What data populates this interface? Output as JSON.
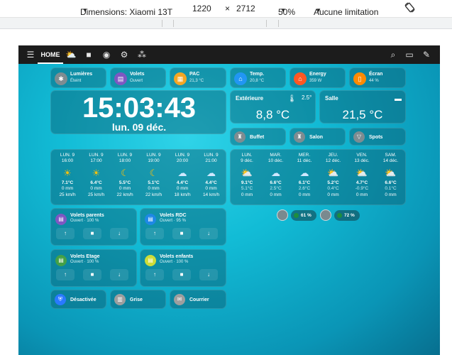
{
  "devtools": {
    "device_label": "Dimensions: Xiaomi 13T",
    "width_value": "1220",
    "times_sign": "×",
    "height_value": "2712",
    "zoom_label": "50%",
    "throttle_label": "Aucune limitation",
    "rotate_icon": "rotate-icon"
  },
  "topbar": {
    "menu_icon": "menu-icon",
    "home_tab": "HOME",
    "tab_icons": [
      "weather-icon",
      "camera-icon",
      "robot-icon",
      "settings-icon",
      "devices-icon"
    ],
    "right_icons": [
      "search-icon",
      "chat-icon",
      "edit-icon"
    ]
  },
  "chips": [
    {
      "label": "Lumières",
      "state": "Éteint",
      "icon": "lightbulb-icon",
      "color": "#7e8c91"
    },
    {
      "label": "Volets",
      "state": "Ouvert",
      "icon": "blinds-icon",
      "color": "#7e57c2"
    },
    {
      "label": "PAC",
      "state": "21,3 °C",
      "icon": "heat-pump-icon",
      "color": "#f5a623"
    },
    {
      "label": "Temp.",
      "state": "20,8 °C",
      "icon": "house-thermometer-icon",
      "color": "#2196f3"
    },
    {
      "label": "Energy",
      "state": "359 W",
      "icon": "house-energy-icon",
      "color": "#ff5722"
    },
    {
      "label": "Écran",
      "state": "44 %",
      "icon": "tablet-icon",
      "color": "#ff8a00"
    }
  ],
  "clock": {
    "time": "15:03:43",
    "date": "lun. 09 déc."
  },
  "thermo": [
    {
      "name": "Extérieure",
      "temp": "8,8 °C",
      "extra": "2.5°",
      "icon": "thermometer-icon"
    },
    {
      "name": "Salle",
      "temp": "21,5 °C",
      "extra": "",
      "icon": "sofa-icon"
    }
  ],
  "rooms": [
    {
      "label": "Buffet",
      "icon": "buffet-lamp-icon"
    },
    {
      "label": "Salon",
      "icon": "floor-lamp-icon"
    },
    {
      "label": "Spots",
      "icon": "spotlight-icon"
    }
  ],
  "hourly": [
    {
      "day": "LUN. 9",
      "time": "16:00",
      "icon": "sun-icon",
      "glyph": "☀",
      "color": "#ffc107",
      "temp": "7.1°C",
      "rain": "0 mm",
      "wind": "25 km/h"
    },
    {
      "day": "LUN. 9",
      "time": "17:00",
      "icon": "sun-icon",
      "glyph": "☀",
      "color": "#ffc107",
      "temp": "6.4°C",
      "rain": "0 mm",
      "wind": "25 km/h"
    },
    {
      "day": "LUN. 9",
      "time": "18:00",
      "icon": "moon-icon",
      "glyph": "☾",
      "color": "#ffc107",
      "temp": "5.5°C",
      "rain": "0 mm",
      "wind": "22 km/h"
    },
    {
      "day": "LUN. 9",
      "time": "19:00",
      "icon": "moon-icon",
      "glyph": "☾",
      "color": "#ffc107",
      "temp": "5.1°C",
      "rain": "0 mm",
      "wind": "22 km/h"
    },
    {
      "day": "LUN. 9",
      "time": "20:00",
      "icon": "partly-cloudy-night-icon",
      "glyph": "☁",
      "color": "#cfe8ff",
      "temp": "4.4°C",
      "rain": "0 mm",
      "wind": "18 km/h"
    },
    {
      "day": "LUN. 9",
      "time": "21:00",
      "icon": "partly-cloudy-night-icon",
      "glyph": "☁",
      "color": "#cfe8ff",
      "temp": "4.4°C",
      "rain": "0 mm",
      "wind": "14 km/h"
    }
  ],
  "daily": [
    {
      "day": "LUN.",
      "date": "9 déc.",
      "icon": "partly-sunny-icon",
      "glyph": "⛅",
      "color": "#ffd54f",
      "hi": "9.1°C",
      "lo": "5.1°C",
      "rain": "0 mm"
    },
    {
      "day": "MAR.",
      "date": "10 déc.",
      "icon": "cloudy-icon",
      "glyph": "☁",
      "color": "#cfe8ff",
      "hi": "6.6°C",
      "lo": "2.5°C",
      "rain": "0 mm"
    },
    {
      "day": "MER.",
      "date": "11 déc.",
      "icon": "cloudy-icon",
      "glyph": "☁",
      "color": "#cfe8ff",
      "hi": "6.1°C",
      "lo": "2.6°C",
      "rain": "0 mm"
    },
    {
      "day": "JEU.",
      "date": "12 déc.",
      "icon": "partly-sunny-icon",
      "glyph": "⛅",
      "color": "#ffd54f",
      "hi": "5.2°C",
      "lo": "0.4°C",
      "rain": "0 mm"
    },
    {
      "day": "VEN.",
      "date": "13 déc.",
      "icon": "partly-sunny-icon",
      "glyph": "⛅",
      "color": "#ffd54f",
      "hi": "4.7°C",
      "lo": "-0.9°C",
      "rain": "0 mm"
    },
    {
      "day": "SAM.",
      "date": "14 déc.",
      "icon": "partly-sunny-icon",
      "glyph": "⛅",
      "color": "#ffd54f",
      "hi": "6.6°C",
      "lo": "0.1°C",
      "rain": "0 mm"
    }
  ],
  "persons": [
    {
      "value": "61 %",
      "avatar": "person-avatar-icon"
    },
    {
      "value": "72 %",
      "avatar": "person-avatar-icon"
    }
  ],
  "covers": [
    {
      "name": "Volets parents",
      "state": "Ouvert · 100 %",
      "icon": "blinds-icon",
      "color": "#7e57c2"
    },
    {
      "name": "Volets RDC",
      "state": "Ouvert · 95 %",
      "icon": "blinds-icon",
      "color": "#1e88e5"
    },
    {
      "name": "Volets Etage",
      "state": "Ouvert · 100 %",
      "icon": "blinds-icon",
      "color": "#43a047"
    },
    {
      "name": "Volets enfants",
      "state": "Ouvert · 100 %",
      "icon": "blinds-icon",
      "color": "#cddc39"
    }
  ],
  "cover_buttons": [
    "↑",
    "■",
    "↓"
  ],
  "bottom": [
    {
      "label": "Désactivée",
      "icon": "shield-icon",
      "color": "#2979ff"
    },
    {
      "label": "Grise",
      "icon": "trash-icon",
      "color": "#9e9e9e"
    },
    {
      "label": "Courrier",
      "icon": "mailbox-icon",
      "color": "#9e9e9e"
    }
  ]
}
